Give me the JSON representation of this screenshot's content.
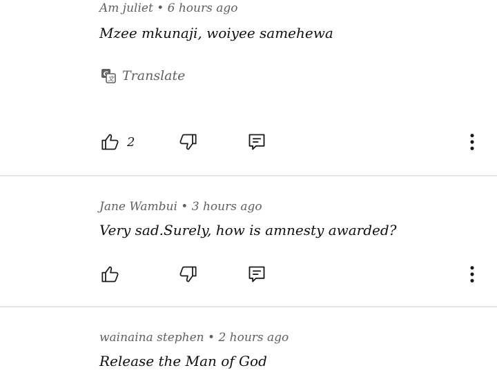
{
  "comments": [
    {
      "author": "Am juliet",
      "separator": "•",
      "time": "6 hours ago",
      "text": "Mzee mkunaji, woiyee samehewa",
      "translate_label": "Translate",
      "likes": "2"
    },
    {
      "author": "Jane Wambui",
      "separator": "•",
      "time": "3 hours ago",
      "text": "Very sad.Surely, how is amnesty awarded?",
      "likes": ""
    },
    {
      "author": "wainaina stephen",
      "separator": "•",
      "time": "2 hours ago",
      "text": "Release the Man of God"
    }
  ],
  "icons": {
    "like": "thumbs-up-icon",
    "dislike": "thumbs-down-icon",
    "reply": "reply-icon",
    "more": "more-vertical-icon",
    "translate": "translate-icon"
  },
  "colors": {
    "meta": "#606060",
    "text": "#0f0f0f",
    "divider": "#e6e6e6"
  }
}
